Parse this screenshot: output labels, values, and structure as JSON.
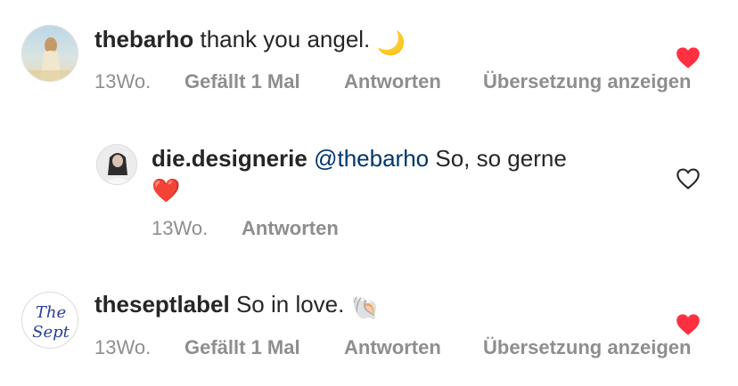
{
  "comments": [
    {
      "username": "thebarho",
      "text": "thank you angel.",
      "emoji": "🌙",
      "time": "13Wo.",
      "likes": "Gefällt 1 Mal",
      "reply": "Antworten",
      "translate": "Übersetzung anzeigen",
      "liked": true
    },
    {
      "username": "die.designerie",
      "mention": "@thebarho",
      "text": "So, so gerne",
      "emoji": "❤️",
      "time": "13Wo.",
      "reply": "Antworten",
      "liked": false
    },
    {
      "username": "theseptlabel",
      "text": "So in love.",
      "emoji": "🐚",
      "time": "13Wo.",
      "likes": "Gefällt 1 Mal",
      "reply": "Antworten",
      "translate": "Übersetzung anzeigen",
      "liked": true,
      "avatar_logo": "The Sept"
    }
  ],
  "colors": {
    "like_red": "#ff3040",
    "mention_blue": "#00376b",
    "meta_gray": "#8e8e8e"
  }
}
